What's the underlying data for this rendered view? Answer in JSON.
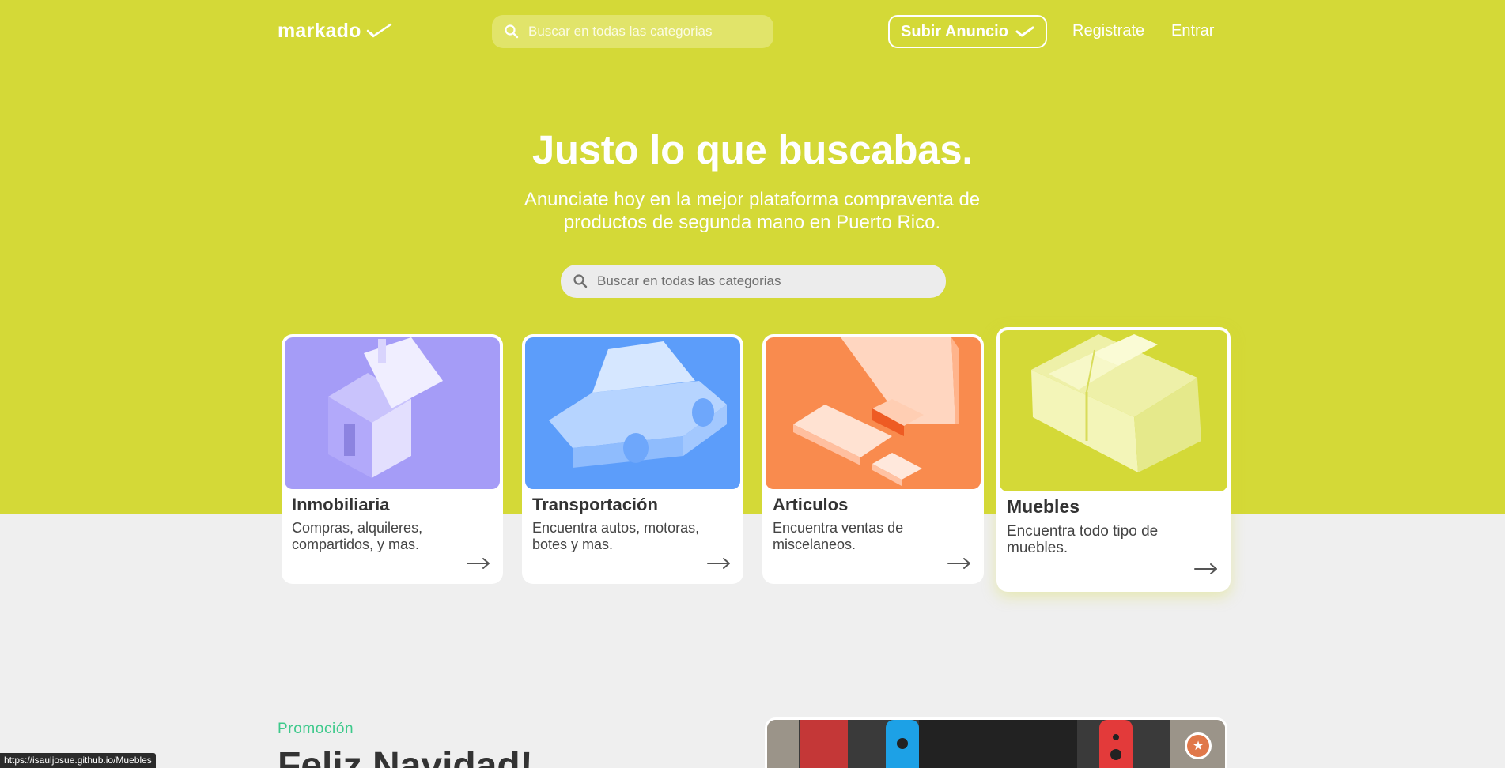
{
  "header": {
    "logo_text": "markado",
    "search_placeholder": "Buscar en todas las categorias",
    "post_button": "Subir Anuncio",
    "register_link": "Registrate",
    "login_link": "Entrar"
  },
  "hero": {
    "title": "Justo lo que buscabas.",
    "subtitle": "Anunciate hoy en la mejor plataforma compraventa de productos de segunda mano en Puerto Rico.",
    "search_placeholder": "Buscar en todas las categorias"
  },
  "categories": [
    {
      "title": "Inmobiliaria",
      "description": "Compras, alquileres, compartidos, y mas.",
      "color": "#a59cf7",
      "icon": "house-icon"
    },
    {
      "title": "Transportación",
      "description": "Encuentra autos, motoras, botes y mas.",
      "color": "#5c9dfa",
      "icon": "car-icon"
    },
    {
      "title": "Articulos",
      "description": "Encuentra ventas de miscelaneos.",
      "color": "#f98b4e",
      "icon": "gadgets-icon"
    },
    {
      "title": "Muebles",
      "description": "Encuentra todo tipo de muebles.",
      "color": "#d4d937",
      "icon": "sofa-icon"
    }
  ],
  "promo": {
    "label": "Promoción",
    "title": "Feliz Navidad!"
  },
  "status_bar": {
    "url": "https://isauljosue.github.io/Muebles"
  },
  "colors": {
    "brand": "#d4d937",
    "accent_green": "#3dc98b",
    "background": "#efefef"
  }
}
